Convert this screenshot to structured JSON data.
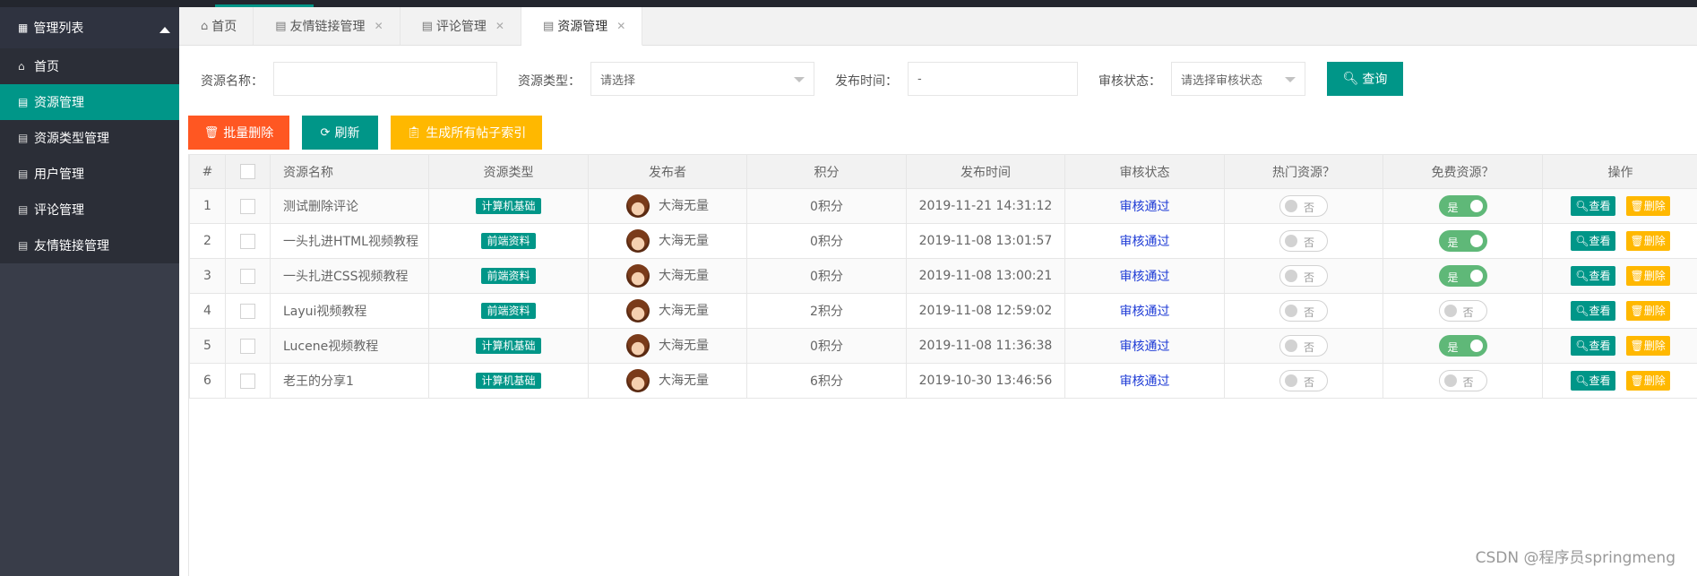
{
  "sidebar": {
    "title": "管理列表",
    "items": [
      {
        "label": "首页",
        "icon": "home-icon",
        "active": false
      },
      {
        "label": "资源管理",
        "icon": "clipboard-icon",
        "active": true
      },
      {
        "label": "资源类型管理",
        "icon": "clipboard-icon",
        "active": false
      },
      {
        "label": "用户管理",
        "icon": "clipboard-icon",
        "active": false
      },
      {
        "label": "评论管理",
        "icon": "clipboard-icon",
        "active": false
      },
      {
        "label": "友情链接管理",
        "icon": "clipboard-icon",
        "active": false
      }
    ]
  },
  "tabs": [
    {
      "label": "首页",
      "icon": "home-icon",
      "closable": false,
      "active": false
    },
    {
      "label": "友情链接管理",
      "icon": "clipboard-icon",
      "closable": true,
      "active": false
    },
    {
      "label": "评论管理",
      "icon": "clipboard-icon",
      "closable": true,
      "active": false
    },
    {
      "label": "资源管理",
      "icon": "clipboard-icon",
      "closable": true,
      "active": true
    }
  ],
  "search": {
    "name_label": "资源名称：",
    "name_value": "",
    "type_label": "资源类型：",
    "type_placeholder": "请选择",
    "time_label": "发布时间：",
    "time_value": "-",
    "status_label": "审核状态：",
    "status_placeholder": "请选择审核状态",
    "query_button": "查询"
  },
  "actions": {
    "batch_delete": "批量删除",
    "refresh": "刷新",
    "generate_index": "生成所有帖子索引",
    "colors": {
      "danger": "#ff5722",
      "primary": "#009688",
      "warm": "#ffb800"
    }
  },
  "table": {
    "headers": [
      "#",
      "",
      "资源名称",
      "资源类型",
      "发布者",
      "积分",
      "发布时间",
      "审核状态",
      "热门资源？",
      "免费资源？",
      "操作"
    ],
    "rows": [
      {
        "no": "1",
        "name": "测试删除评论",
        "type": "计算机基础",
        "publisher": "大海无量",
        "points": "0积分",
        "time": "2019-11-21 14:31:12",
        "status": "审核通过",
        "hot": false,
        "hot_label": "否",
        "free": true,
        "free_label": "是"
      },
      {
        "no": "2",
        "name": "一头扎进HTML视频教程",
        "type": "前端资料",
        "publisher": "大海无量",
        "points": "0积分",
        "time": "2019-11-08 13:01:57",
        "status": "审核通过",
        "hot": false,
        "hot_label": "否",
        "free": true,
        "free_label": "是"
      },
      {
        "no": "3",
        "name": "一头扎进CSS视频教程",
        "type": "前端资料",
        "publisher": "大海无量",
        "points": "0积分",
        "time": "2019-11-08 13:00:21",
        "status": "审核通过",
        "hot": false,
        "hot_label": "否",
        "free": true,
        "free_label": "是"
      },
      {
        "no": "4",
        "name": "Layui视频教程",
        "type": "前端资料",
        "publisher": "大海无量",
        "points": "2积分",
        "time": "2019-11-08 12:59:02",
        "status": "审核通过",
        "hot": false,
        "hot_label": "否",
        "free": false,
        "free_label": "否"
      },
      {
        "no": "5",
        "name": "Lucene视频教程",
        "type": "计算机基础",
        "publisher": "大海无量",
        "points": "0积分",
        "time": "2019-11-08 11:36:38",
        "status": "审核通过",
        "hot": false,
        "hot_label": "否",
        "free": true,
        "free_label": "是"
      },
      {
        "no": "6",
        "name": "老王的分享1",
        "type": "计算机基础",
        "publisher": "大海无量",
        "points": "6积分",
        "time": "2019-10-30 13:46:56",
        "status": "审核通过",
        "hot": false,
        "hot_label": "否",
        "free": false,
        "free_label": "否"
      }
    ],
    "view_label": "查看",
    "delete_label": "删除"
  },
  "watermark": "CSDN @程序员springmeng"
}
